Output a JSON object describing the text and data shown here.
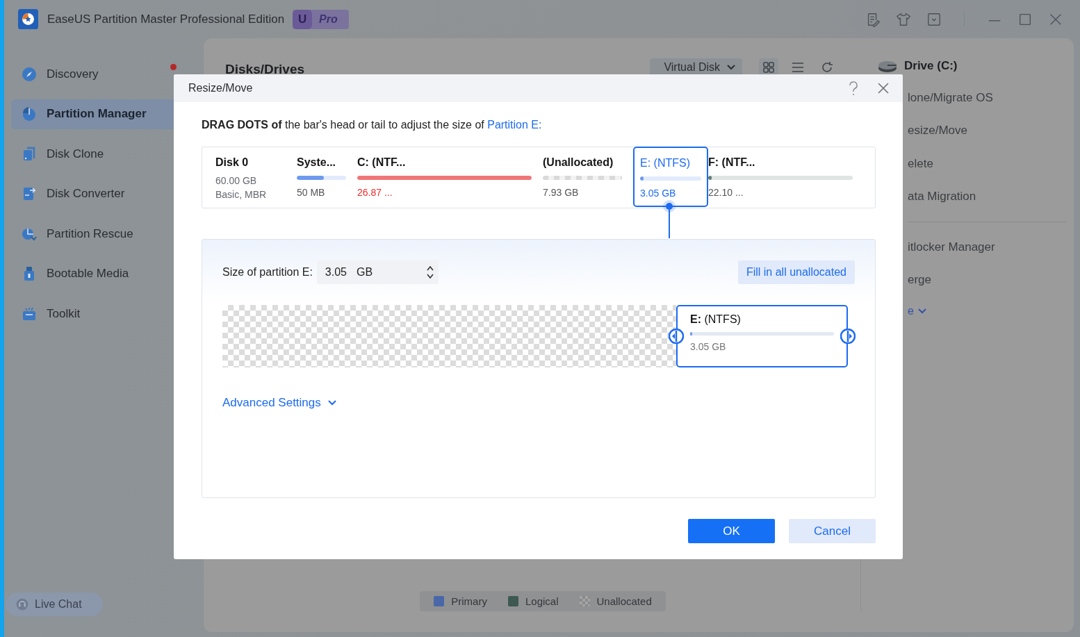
{
  "app": {
    "title": "EaseUS Partition Master Professional Edition",
    "badge_letter": "U",
    "badge_label": "Pro"
  },
  "sidebar": {
    "items": [
      {
        "label": "Discovery",
        "kind": "compass",
        "selected": false,
        "notification": true
      },
      {
        "label": "Partition Manager",
        "kind": "pie",
        "selected": true,
        "notification": false
      },
      {
        "label": "Disk Clone",
        "kind": "clone",
        "selected": false,
        "notification": false
      },
      {
        "label": "Disk Converter",
        "kind": "convert",
        "selected": false,
        "notification": false
      },
      {
        "label": "Partition Rescue",
        "kind": "rescue",
        "selected": false,
        "notification": false
      },
      {
        "label": "Bootable Media",
        "kind": "usb",
        "selected": false,
        "notification": false
      },
      {
        "label": "Toolkit",
        "kind": "toolkit",
        "selected": false,
        "notification": false
      }
    ],
    "live_chat": "Live Chat"
  },
  "main": {
    "heading": "Disks/Drives",
    "view_dropdown": "Virtual Disk",
    "legend": [
      {
        "label": "Primary",
        "kind": "solid",
        "color": "#4a67a8"
      },
      {
        "label": "Logical",
        "kind": "solid",
        "color": "#3e5852"
      },
      {
        "label": "Unallocated",
        "kind": "checker"
      }
    ]
  },
  "drive_panel": {
    "title": "Drive (C:)",
    "action_groups": [
      [
        {
          "label": "lone/Migrate OS"
        },
        {
          "label": "esize/Move"
        },
        {
          "label": "elete"
        },
        {
          "label": "ata Migration"
        }
      ],
      [
        {
          "label": "itlocker Manager"
        },
        {
          "label": "erge"
        }
      ]
    ],
    "more": "e"
  },
  "dialog": {
    "title": "Resize/Move",
    "instruction": "**DRAG DOTS of** the bar's head or tail to adjust the size of ",
    "instruction_link": "Partition E:",
    "disk": {
      "name": "Disk 0",
      "size": "60.00 GB",
      "type": "Basic, MBR"
    },
    "partitions": [
      {
        "label": "Syste...",
        "size": "50 MB",
        "kind": "used",
        "color": "#6d9aee",
        "level": 0.55,
        "selected": false,
        "low_space": false
      },
      {
        "label": "C: (NTF...",
        "size": "26.87 ...",
        "kind": "used",
        "color": "#f07678",
        "level": 1,
        "selected": false,
        "low_space": true
      },
      {
        "label": "(Unallocated)",
        "size": "7.93 GB",
        "kind": "unallocated",
        "selected": false,
        "low_space": false
      },
      {
        "label": "E: (NTFS)",
        "size": "3.05 GB",
        "kind": "used",
        "color": "#6d9aee",
        "level": 0.04,
        "selected": true,
        "low_space": false
      },
      {
        "label": "F: (NTF...",
        "size": "22.10 ...",
        "kind": "used",
        "color": "#5e7f73",
        "level": 0.02,
        "selected": false,
        "low_space": false
      }
    ],
    "size_label": "Size of partition E:",
    "size_value": "3.05",
    "size_unit": "GB",
    "fill_button": "Fill in all unallocated",
    "resize_bar": {
      "label": "**E:** (NTFS)",
      "size": "3.05 GB",
      "level": 0.01
    },
    "advanced": "Advanced Settings",
    "buttons": [
      {
        "label": "OK",
        "kind": "primary"
      },
      {
        "label": "Cancel",
        "kind": "secondary"
      }
    ]
  }
}
